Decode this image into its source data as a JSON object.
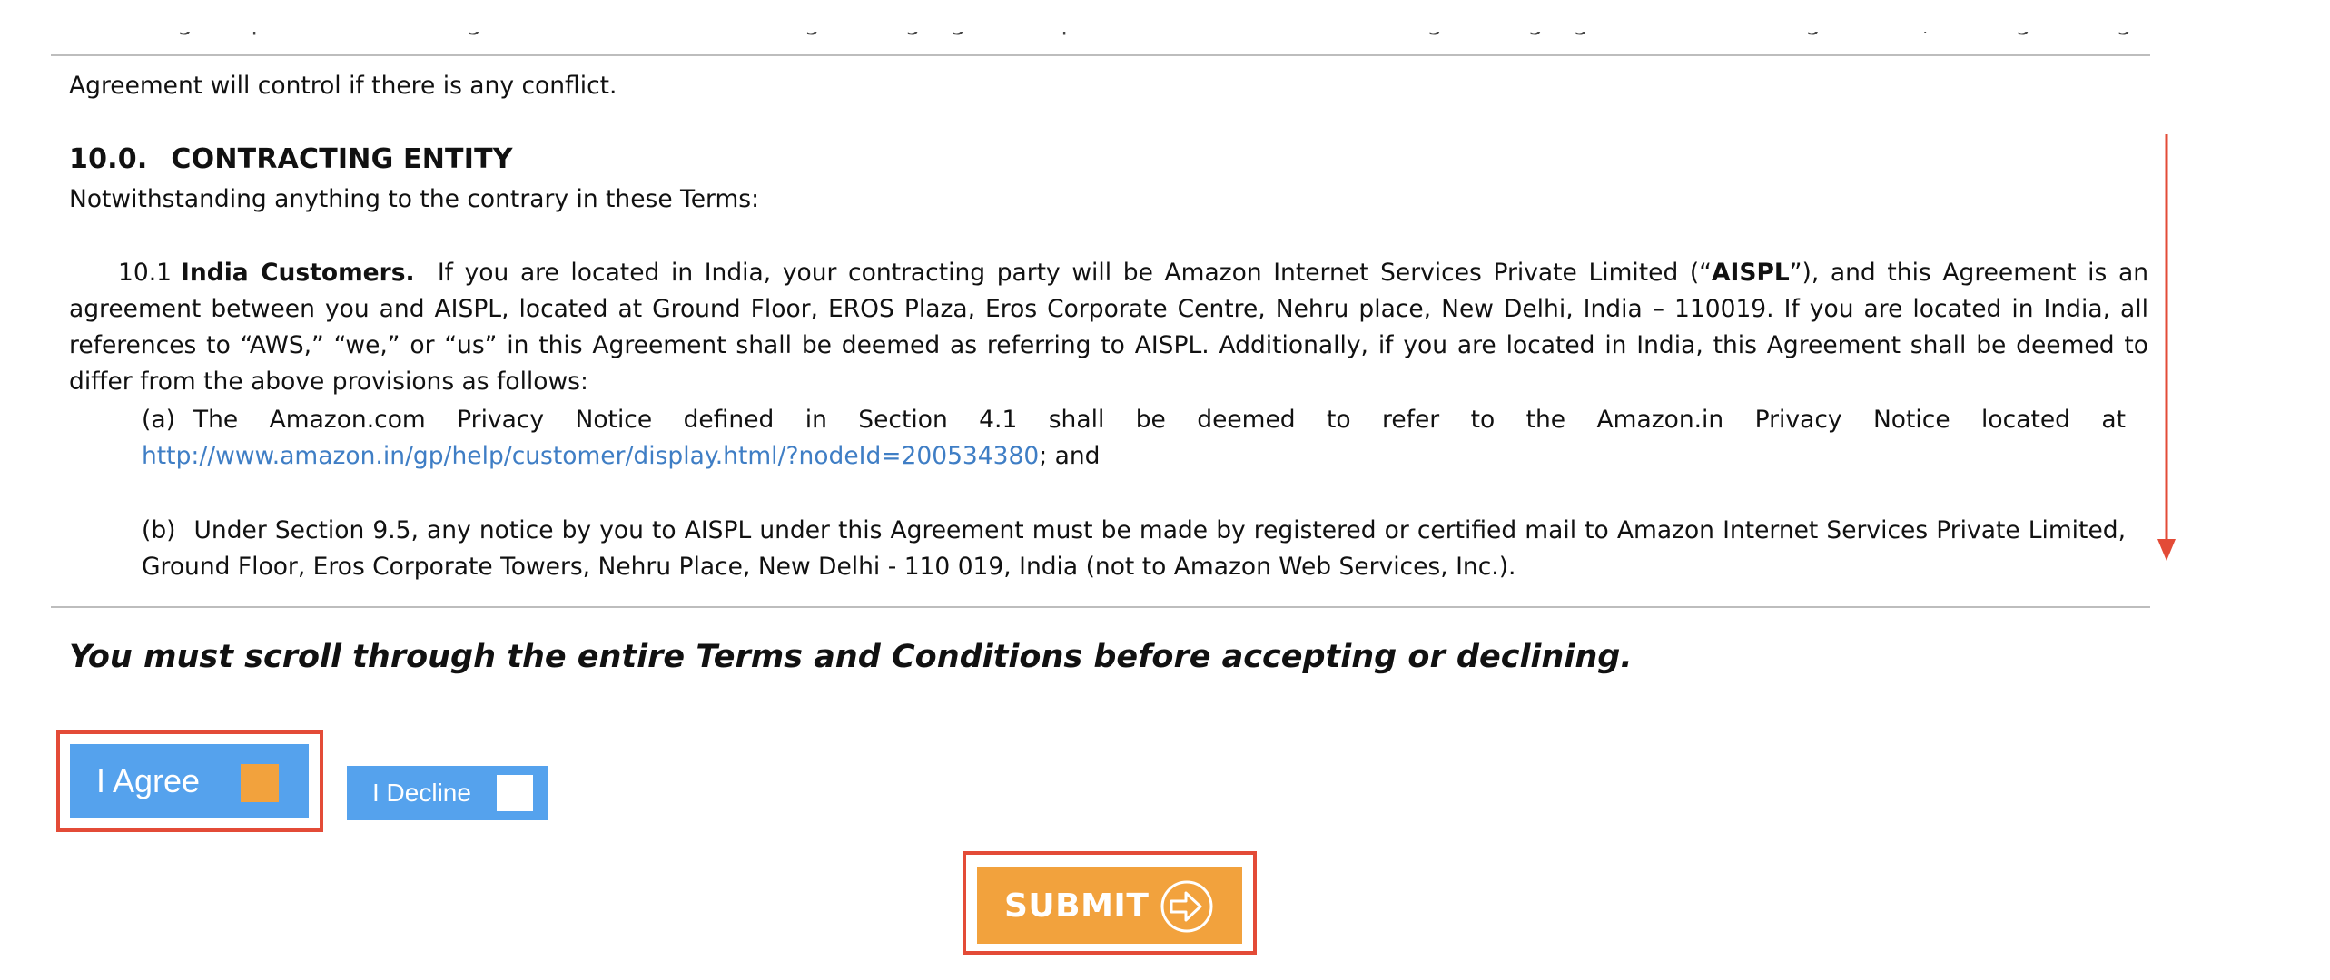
{
  "terms": {
    "cut_top_line": "made or given pursuant to this Agreement must be in the English language. If we provide a translation of the English language version of this Agreement, the English language version of this",
    "prev_para_end": "Agreement will control if there is any conflict.",
    "section_number": "10.0.",
    "section_title": "CONTRACTING ENTITY",
    "section_intro": "Notwithstanding anything to the contrary in these Terms:",
    "india": {
      "number": "10.1",
      "heading": "India Customers.",
      "text_1": "If you are located in India, your contracting party will be Amazon Internet Services Private Limited (“",
      "aispl_bold": "AISPL",
      "text_2": "”), and this Agreement is an agreement between you and AISPL, located at Ground Floor, EROS Plaza, Eros Corporate Centre, Nehru place, New Delhi, India – 110019.  If you are located in India, all references to “AWS,” “we,” or “us” in this Agreement shall be deemed as referring to AISPL.  Additionally, if you are located in India, this Agreement shall be deemed to differ from the above provisions as follows:"
    },
    "item_a": {
      "label": "(a)",
      "text": "The Amazon.com Privacy Notice defined in Section 4.1 shall be deemed to refer to the Amazon.in Privacy Notice located at",
      "link": "http://www.amazon.in/gp/help/customer/display.html/?nodeId=200534380",
      "after_link": "; and"
    },
    "item_b": {
      "label": "(b)",
      "text": "Under Section 9.5, any notice by you to AISPL under this Agreement must be made by registered or certified mail to Amazon Internet Services Private Limited, Ground Floor, Eros Corporate Towers, Nehru Place, New Delhi - 110 019, India (not to Amazon Web Services, Inc.)."
    }
  },
  "scroll_notice": "You must scroll through the entire Terms and Conditions before accepting or declining.",
  "buttons": {
    "agree_label": "I Agree",
    "decline_label": "I Decline",
    "submit_label": "SUBMIT"
  },
  "icons": {
    "scroll": "arrow-down-icon",
    "agree_check": "checkbox-checked-icon",
    "decline_check": "checkbox-empty-icon",
    "submit": "arrow-circle-right-icon"
  },
  "colors": {
    "button_blue": "#55a2ed",
    "accent_orange": "#f2a23d",
    "highlight_red": "#e34b37",
    "link_blue": "#3f7ec5"
  }
}
